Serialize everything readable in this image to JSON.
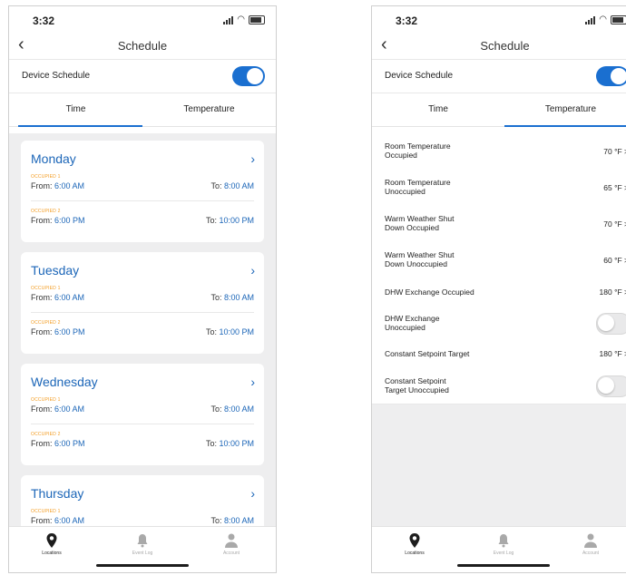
{
  "left": {
    "status": {
      "time": "3:32"
    },
    "nav": {
      "title": "Schedule"
    },
    "device_schedule": {
      "label": "Device Schedule",
      "enabled": true
    },
    "tabs": [
      {
        "label": "Time",
        "active": true
      },
      {
        "label": "Temperature",
        "active": false
      }
    ],
    "days": [
      {
        "name": "Monday",
        "slots": [
          {
            "label": "OCCUPIED 1",
            "from_prefix": "From: ",
            "from": "6:00 AM",
            "to_prefix": "To: ",
            "to": "8:00 AM"
          },
          {
            "label": "OCCUPIED 2",
            "from_prefix": "From: ",
            "from": "6:00 PM",
            "to_prefix": "To: ",
            "to": "10:00 PM"
          }
        ]
      },
      {
        "name": "Tuesday",
        "slots": [
          {
            "label": "OCCUPIED 1",
            "from_prefix": "From: ",
            "from": "6:00 AM",
            "to_prefix": "To: ",
            "to": "8:00 AM"
          },
          {
            "label": "OCCUPIED 2",
            "from_prefix": "From: ",
            "from": "6:00 PM",
            "to_prefix": "To: ",
            "to": "10:00 PM"
          }
        ]
      },
      {
        "name": "Wednesday",
        "slots": [
          {
            "label": "OCCUPIED 1",
            "from_prefix": "From: ",
            "from": "6:00 AM",
            "to_prefix": "To: ",
            "to": "8:00 AM"
          },
          {
            "label": "OCCUPIED 2",
            "from_prefix": "From: ",
            "from": "6:00 PM",
            "to_prefix": "To: ",
            "to": "10:00 PM"
          }
        ]
      },
      {
        "name": "Thursday",
        "slots": [
          {
            "label": "OCCUPIED 1",
            "from_prefix": "From: ",
            "from": "6:00 AM",
            "to_prefix": "To: ",
            "to": "8:00 AM"
          }
        ]
      }
    ],
    "tabbar": [
      {
        "label": "Locations",
        "icon": "location-pin-icon",
        "active": true
      },
      {
        "label": "Event Log",
        "icon": "bell-icon",
        "active": false
      },
      {
        "label": "Account",
        "icon": "person-icon",
        "active": false
      }
    ]
  },
  "right": {
    "status": {
      "time": "3:32"
    },
    "nav": {
      "title": "Schedule"
    },
    "device_schedule": {
      "label": "Device Schedule",
      "enabled": true
    },
    "tabs": [
      {
        "label": "Time",
        "active": false
      },
      {
        "label": "Temperature",
        "active": true
      }
    ],
    "rows": [
      {
        "line1": "Room Temperature",
        "line2": "Occupied",
        "value": "70 °F >",
        "type": "value"
      },
      {
        "line1": "Room Temperature",
        "line2": "Unoccupied",
        "value": "65 °F >",
        "type": "value"
      },
      {
        "line1": "Warm Weather Shut",
        "line2": "Down Occupied",
        "value": "70 °F >",
        "type": "value"
      },
      {
        "line1": "Warm Weather Shut",
        "line2": "Down Unoccupied",
        "value": "60 °F >",
        "type": "value"
      },
      {
        "line1": "DHW Exchange Occupied",
        "line2": "",
        "value": "180 °F >",
        "type": "value"
      },
      {
        "line1": "DHW Exchange",
        "line2": "Unoccupied",
        "value": "",
        "type": "toggle",
        "enabled": false
      },
      {
        "line1": "Constant Setpoint Target",
        "line2": "",
        "value": "180 °F >",
        "type": "value"
      },
      {
        "line1": "Constant Setpoint",
        "line2": "Target Unoccupied",
        "value": "",
        "type": "toggle",
        "enabled": false
      }
    ],
    "tabbar": [
      {
        "label": "Locations",
        "icon": "location-pin-icon",
        "active": true
      },
      {
        "label": "Event Log",
        "icon": "bell-icon",
        "active": false
      },
      {
        "label": "Account",
        "icon": "person-icon",
        "active": false
      }
    ]
  },
  "colors": {
    "accent": "#1a6fd0",
    "occupied_label": "#f39a1d",
    "background": "#eeeeef"
  }
}
